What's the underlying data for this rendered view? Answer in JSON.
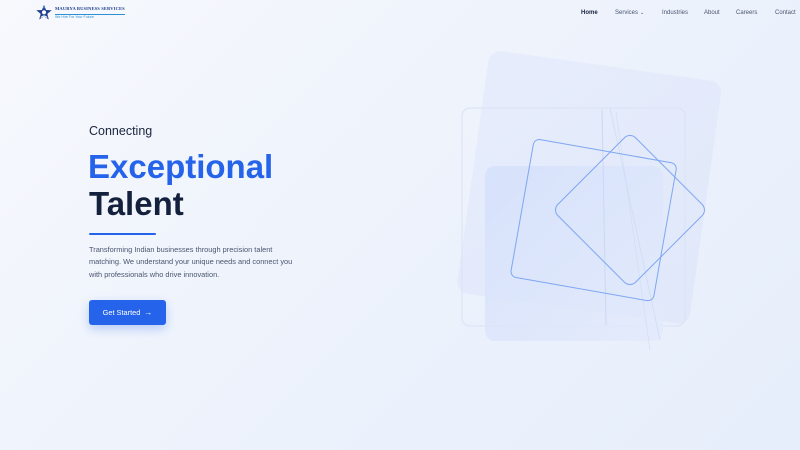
{
  "brand": {
    "name": "MAURYA BUSINESS SERVICES",
    "tagline": "We Hire For Your Future"
  },
  "nav": {
    "items": [
      {
        "label": "Home",
        "active": true
      },
      {
        "label": "Services",
        "has_dropdown": true
      },
      {
        "label": "Industries"
      },
      {
        "label": "About"
      },
      {
        "label": "Careers"
      },
      {
        "label": "Contact"
      }
    ]
  },
  "hero": {
    "eyebrow": "Connecting",
    "headline_line1": "Exceptional",
    "headline_line2": "Talent",
    "description": "Transforming Indian businesses through precision talent matching. We understand your unique needs and connect you with professionals who drive innovation.",
    "cta_label": "Get Started",
    "cta_icon": "arrow-right-icon"
  },
  "colors": {
    "accent": "#2563eb",
    "heading_dark": "#14213d",
    "text_muted": "#4b5570",
    "background": "#eef3fc"
  }
}
